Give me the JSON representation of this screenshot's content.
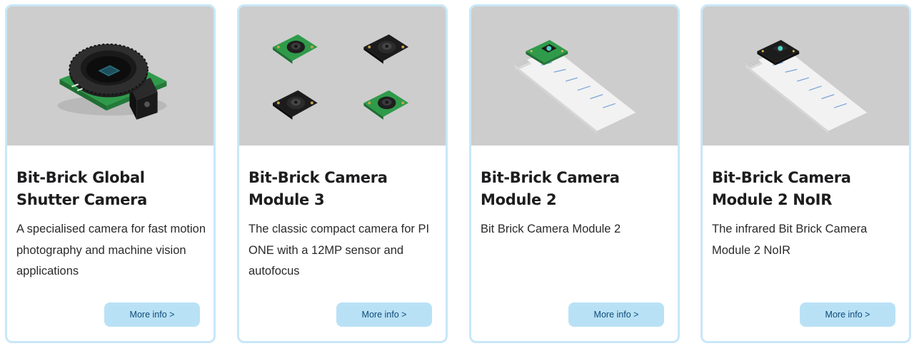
{
  "cards": [
    {
      "title": "Bit-Brick Global Shutter Camera",
      "description": "A specialised camera for fast motion photography and machine vision applications",
      "button_label": "More info >",
      "image_icon": "global-shutter-camera-icon"
    },
    {
      "title": "Bit-Brick Camera Module 3",
      "description": "The classic compact camera for PI ONE with a 12MP sensor and autofocus",
      "button_label": "More info >",
      "image_icon": "camera-module-3-set-icon"
    },
    {
      "title": "Bit-Brick Camera Module 2",
      "description": "Bit Brick Camera Module 2",
      "button_label": "More info >",
      "image_icon": "camera-module-2-ribbon-icon"
    },
    {
      "title": "Bit-Brick Camera Module 2 NoIR",
      "description": "The infrared Bit Brick Camera Module 2 NoIR",
      "button_label": "More info >",
      "image_icon": "camera-module-2-noir-ribbon-icon"
    }
  ],
  "colors": {
    "card_border": "#c8e7f7",
    "image_background": "#cdcdcd",
    "button_background": "#b9e1f6",
    "button_text": "#0f4b7a",
    "pcb_green": "#2f9b4a",
    "pcb_black": "#1c1c1c"
  }
}
